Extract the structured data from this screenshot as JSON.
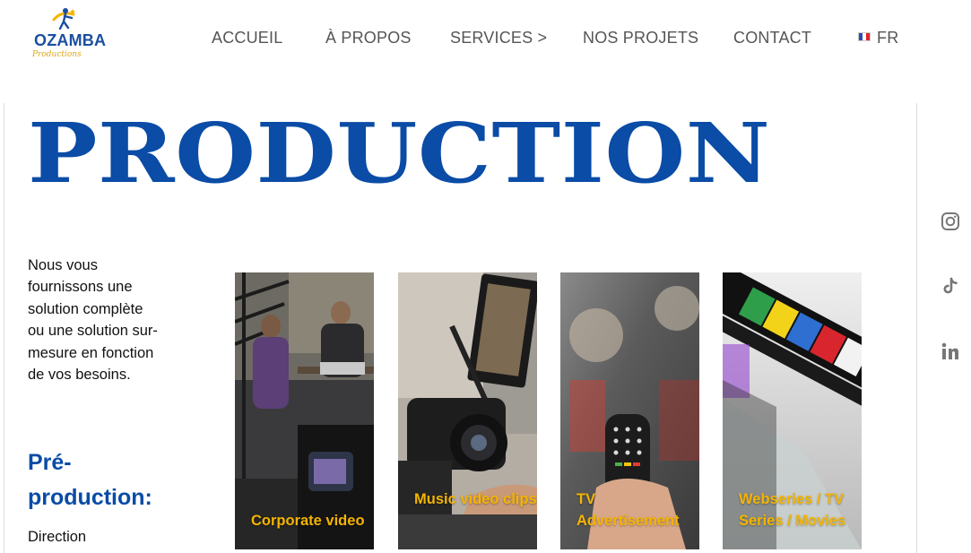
{
  "brand": {
    "name": "OZAMBA",
    "tagline": "Productions",
    "logo_icon": "dancer-star-logo-icon"
  },
  "nav": {
    "items": [
      {
        "label": "ACCUEIL"
      },
      {
        "label": "À PROPOS"
      },
      {
        "label": "SERVICES >"
      },
      {
        "label": "NOS PROJETS"
      },
      {
        "label": "CONTACT"
      }
    ],
    "language": {
      "label": "FR",
      "icon": "french-flag-icon"
    }
  },
  "page": {
    "title": "PRODUCTION",
    "intro": "Nous vous fournissons une solution complète ou une solution sur-mesure en fonction de vos besoins.",
    "subhead": "Pré-production:",
    "first_item": "Direction"
  },
  "cards": [
    {
      "label": "Corporate video"
    },
    {
      "label": "Music video clips"
    },
    {
      "label": "TV Advertisement"
    },
    {
      "label": "Webseries / TV Series / Movies"
    }
  ],
  "social": [
    {
      "icon": "instagram-icon"
    },
    {
      "icon": "tiktok-icon"
    },
    {
      "icon": "linkedin-icon"
    }
  ],
  "colors": {
    "brand_blue": "#0a4ca6",
    "accent_yellow": "#f4b400",
    "nav_text": "#555555"
  }
}
